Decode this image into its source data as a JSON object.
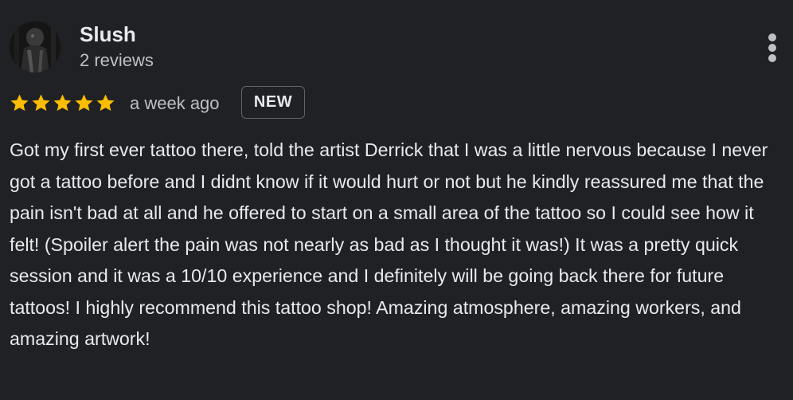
{
  "reviewer": {
    "name": "Slush",
    "review_count": "2 reviews"
  },
  "review": {
    "rating": 5,
    "max_rating": 5,
    "date": "a week ago",
    "badge": "NEW",
    "text": "Got my first ever tattoo there, told the artist Derrick that I was a little nervous because I never got a tattoo before and I didnt know if it would hurt or not but he kindly reassured me that the pain isn't bad at all and he offered to start on a small area of the tattoo so I could see how it felt! (Spoiler alert the pain was not nearly as bad as I thought it was!) It was a pretty quick session and it was a 10/10 experience and I definitely will be going back there for future tattoos! I highly recommend this tattoo shop! Amazing atmosphere, amazing workers, and amazing artwork!"
  },
  "icons": {
    "menu": "more-vert-icon",
    "star": "star-icon"
  },
  "colors": {
    "background": "#202124",
    "primary_text": "#e8eaed",
    "secondary_text": "#bdc1c6",
    "star": "#fbbc04",
    "badge_border": "#5f6368"
  }
}
